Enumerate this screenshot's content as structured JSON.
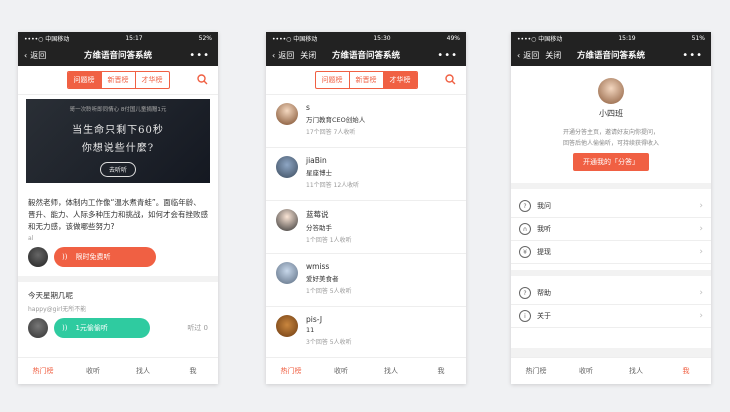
{
  "colors": {
    "accent": "#f06043",
    "green": "#2fcba0",
    "dark": "#222222"
  },
  "screen1": {
    "status": {
      "carrier": "••••○ 中国移动",
      "time": "15:17",
      "battery": "52%"
    },
    "nav": {
      "back": "返回",
      "title": "方维语音问答系统",
      "more": "•••"
    },
    "tabs": [
      "问题榜",
      "新晋榜",
      "才华榜"
    ],
    "banner": {
      "sub": "哥一次聆听即同情心 8付国儿童捐赠1元",
      "line1": "当生命只剩下60秒",
      "line2": "你想说些什麼?",
      "btn": "去听听"
    },
    "q1": {
      "text": "毅然老师，体制内工作像“温水煮青蛙”。面临年龄、晋升、能力、人际多种压力和挑战，如何才会有挫败感和无力感，该做哪些努力?",
      "meta": "al",
      "answer": "限时免费听"
    },
    "q2": {
      "text": "今天星期几呢",
      "meta": "happy@girl无所不能",
      "answer": "1元偷偷听",
      "listen": "听过 0"
    },
    "bottom": [
      "热门榜",
      "收听",
      "找人",
      "我"
    ]
  },
  "screen2": {
    "status": {
      "carrier": "••••○ 中国移动",
      "time": "15:30",
      "battery": "49%"
    },
    "nav": {
      "back": "返回",
      "close": "关闭",
      "title": "方维语音问答系统",
      "more": "•••"
    },
    "tabs": [
      "问题榜",
      "新晋榜",
      "才华榜"
    ],
    "items": [
      {
        "name": "s",
        "desc": "万门教育CEO创始人",
        "stats": "17个回答 7人收听"
      },
      {
        "name": "jiaBin",
        "desc": "星座博士",
        "stats": "11个回答 12人收听"
      },
      {
        "name": "蓝莓说",
        "desc": "分答助手",
        "stats": "1个回答 1人收听"
      },
      {
        "name": "wmiss",
        "desc": "爱好美食者",
        "stats": "1个回答 5人收听"
      },
      {
        "name": "pis-J",
        "desc": "11",
        "stats": "3个回答 5人收听"
      }
    ],
    "bottom": [
      "热门榜",
      "收听",
      "找人",
      "我"
    ]
  },
  "screen3": {
    "status": {
      "carrier": "••••○ 中国移动",
      "time": "15:19",
      "battery": "51%"
    },
    "nav": {
      "back": "返回",
      "close": "关闭",
      "title": "方维语音问答系统",
      "more": "•••"
    },
    "name": "小四班",
    "intro1": "开通分答主页，邀请好友向你提问，",
    "intro2": "回答后他人偷偷听，可持续获得收入",
    "open_btn": "开通我的「分答」",
    "menu1": [
      "我问",
      "我听",
      "提现"
    ],
    "menu2": [
      "帮助",
      "关于"
    ],
    "bottom": [
      "热门榜",
      "收听",
      "找人",
      "我"
    ]
  }
}
